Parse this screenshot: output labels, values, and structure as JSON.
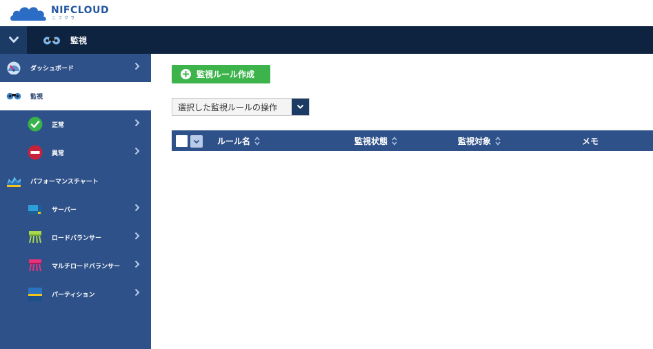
{
  "logo": {
    "title": "NIFCLOUD",
    "subtitle": "ニフクラ"
  },
  "topnav": {
    "section_label": "監視",
    "toggle_icon": "chevron-down-icon",
    "section_icon": "binoculars-icon"
  },
  "sidebar": {
    "items": [
      {
        "label": "ダッシュボード",
        "icon": "dashboard-gauge-icon"
      },
      {
        "label": "監視",
        "icon": "binoculars-icon"
      },
      {
        "label": "正常",
        "icon": "check-circle-icon"
      },
      {
        "label": "異常",
        "icon": "no-entry-icon"
      },
      {
        "label": "パフォーマンスチャート",
        "icon": "performance-chart-icon"
      },
      {
        "label": "サーバー",
        "icon": "server-icon"
      },
      {
        "label": "ロードバランサー",
        "icon": "load-balancer-icon"
      },
      {
        "label": "マルチロードバランサー",
        "icon": "multi-load-balancer-icon"
      },
      {
        "label": "パーティション",
        "icon": "partition-icon"
      }
    ]
  },
  "main": {
    "create_button_label": "監視ルール作成",
    "operation_select_label": "選択した監視ルールの操作",
    "table": {
      "columns": [
        "ルール名",
        "監視状態",
        "監視対象",
        "メモ"
      ]
    }
  },
  "colors": {
    "nav_dark": "#0d2340",
    "sidebar_blue": "#2f5189",
    "accent_green": "#3db44b",
    "logo_blue": "#23569f"
  }
}
